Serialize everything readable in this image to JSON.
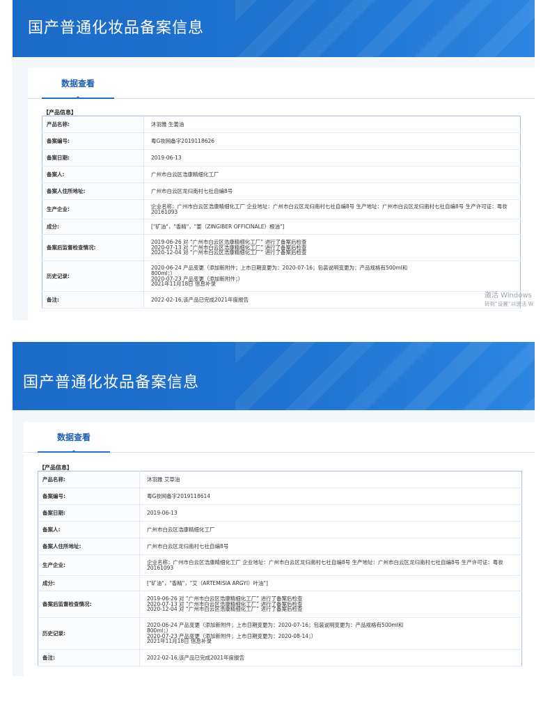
{
  "records": [
    {
      "banner_title": "国产普通化妆品备案信息",
      "tab_label": "数据查看",
      "section_title": "【产品信息】",
      "rows": [
        {
          "label": "产品名称:",
          "value": "沐羽雅 生姜油"
        },
        {
          "label": "备案编号:",
          "value": "粤G妆网备字2019118626"
        },
        {
          "label": "备案日期:",
          "value": "2019-06-13"
        },
        {
          "label": "备案人:",
          "value": "广州市白云区浩康精细化工厂"
        },
        {
          "label": "备案人住所地址:",
          "value": "广州市白云区龙归南村七社自编8号"
        },
        {
          "label": "生产企业:",
          "value": "企业名称：广州市白云区浩康精细化工厂 企业地址：广州市白云区龙归南村七社自编8号 生产地址：广州市白云区龙归南村七社自编8号 生产许可证：粤妆20161093"
        },
        {
          "label": "成分:",
          "value": "[\"矿油\"，\"香精\"，\"姜（ZINGIBER OFFICINALE）根油\"]"
        },
        {
          "label": "备案后监督检查情况:",
          "value": "2019-06-26 对 “广州市白云区浩康精细化工厂” 进行了备案后检查\n2020-07-13 对 “广州市白云区浩康精细化工厂” 进行了备案后检查\n2020-12-04 对 “广州市白云区浩康精细化工厂” 进行了备案后检查"
        },
        {
          "label": "历史记录:",
          "value": "2020-06-24 产品变更（添加新附件；上市日期变更为：2020-07-16；包装说明变更为：产品规格有500ml和\n800ml；）\n2020-07-23 产品变更（添加新附件；）\n2021年11月18日 信息补录"
        },
        {
          "label": "备注:",
          "value": "2022-02-16,该产品已完成2021年度报告"
        }
      ]
    },
    {
      "banner_title": "国产普通化妆品备案信息",
      "tab_label": "数据查看",
      "section_title": "【产品信息】",
      "rows": [
        {
          "label": "产品名称:",
          "value": "沐羽雅 艾草油"
        },
        {
          "label": "备案编号:",
          "value": "粤G妆网备字2019118614"
        },
        {
          "label": "备案日期:",
          "value": "2019-06-13"
        },
        {
          "label": "备案人:",
          "value": "广州市白云区浩康精细化工厂"
        },
        {
          "label": "备案人住所地址:",
          "value": "广州市白云区龙归南村七社自编8号"
        },
        {
          "label": "生产企业:",
          "value": "企业名称：广州市白云区浩康精细化工厂 企业地址：广州市白云区龙归南村七社自编8号 生产地址：广州市白云区龙归南村七社自编8号 生产许可证：粤妆20161093"
        },
        {
          "label": "成分:",
          "value": "[\"矿油\"，\"香精\"，\"艾（ARTEMISIA ARGYI）叶油\"]"
        },
        {
          "label": "备案后监督检查情况:",
          "value": "2019-06-26 对 “广州市白云区浩康精细化工厂” 进行了备案后检查\n2020-07-13 对 “广州市白云区浩康精细化工厂” 进行了备案后检查\n2020-12-04 对 “广州市白云区浩康精细化工厂” 进行了备案后检查"
        },
        {
          "label": "历史记录:",
          "value": "2020-06-24 产品变更（添加新附件；上市日期变更为：2020-07-16；包装说明变更为：产品规格有500ml和\n800ml；）\n2020-07-23 产品变更（添加新附件；上市日期变更为：2020-08-14；）\n2021年11月18日 信息补录"
        },
        {
          "label": "备注:",
          "value": "2022-02-16,该产品已完成2021年度报告"
        }
      ]
    }
  ],
  "watermark": {
    "line1": "激活 Windows",
    "line2": "转到“设置”以激活 W"
  }
}
